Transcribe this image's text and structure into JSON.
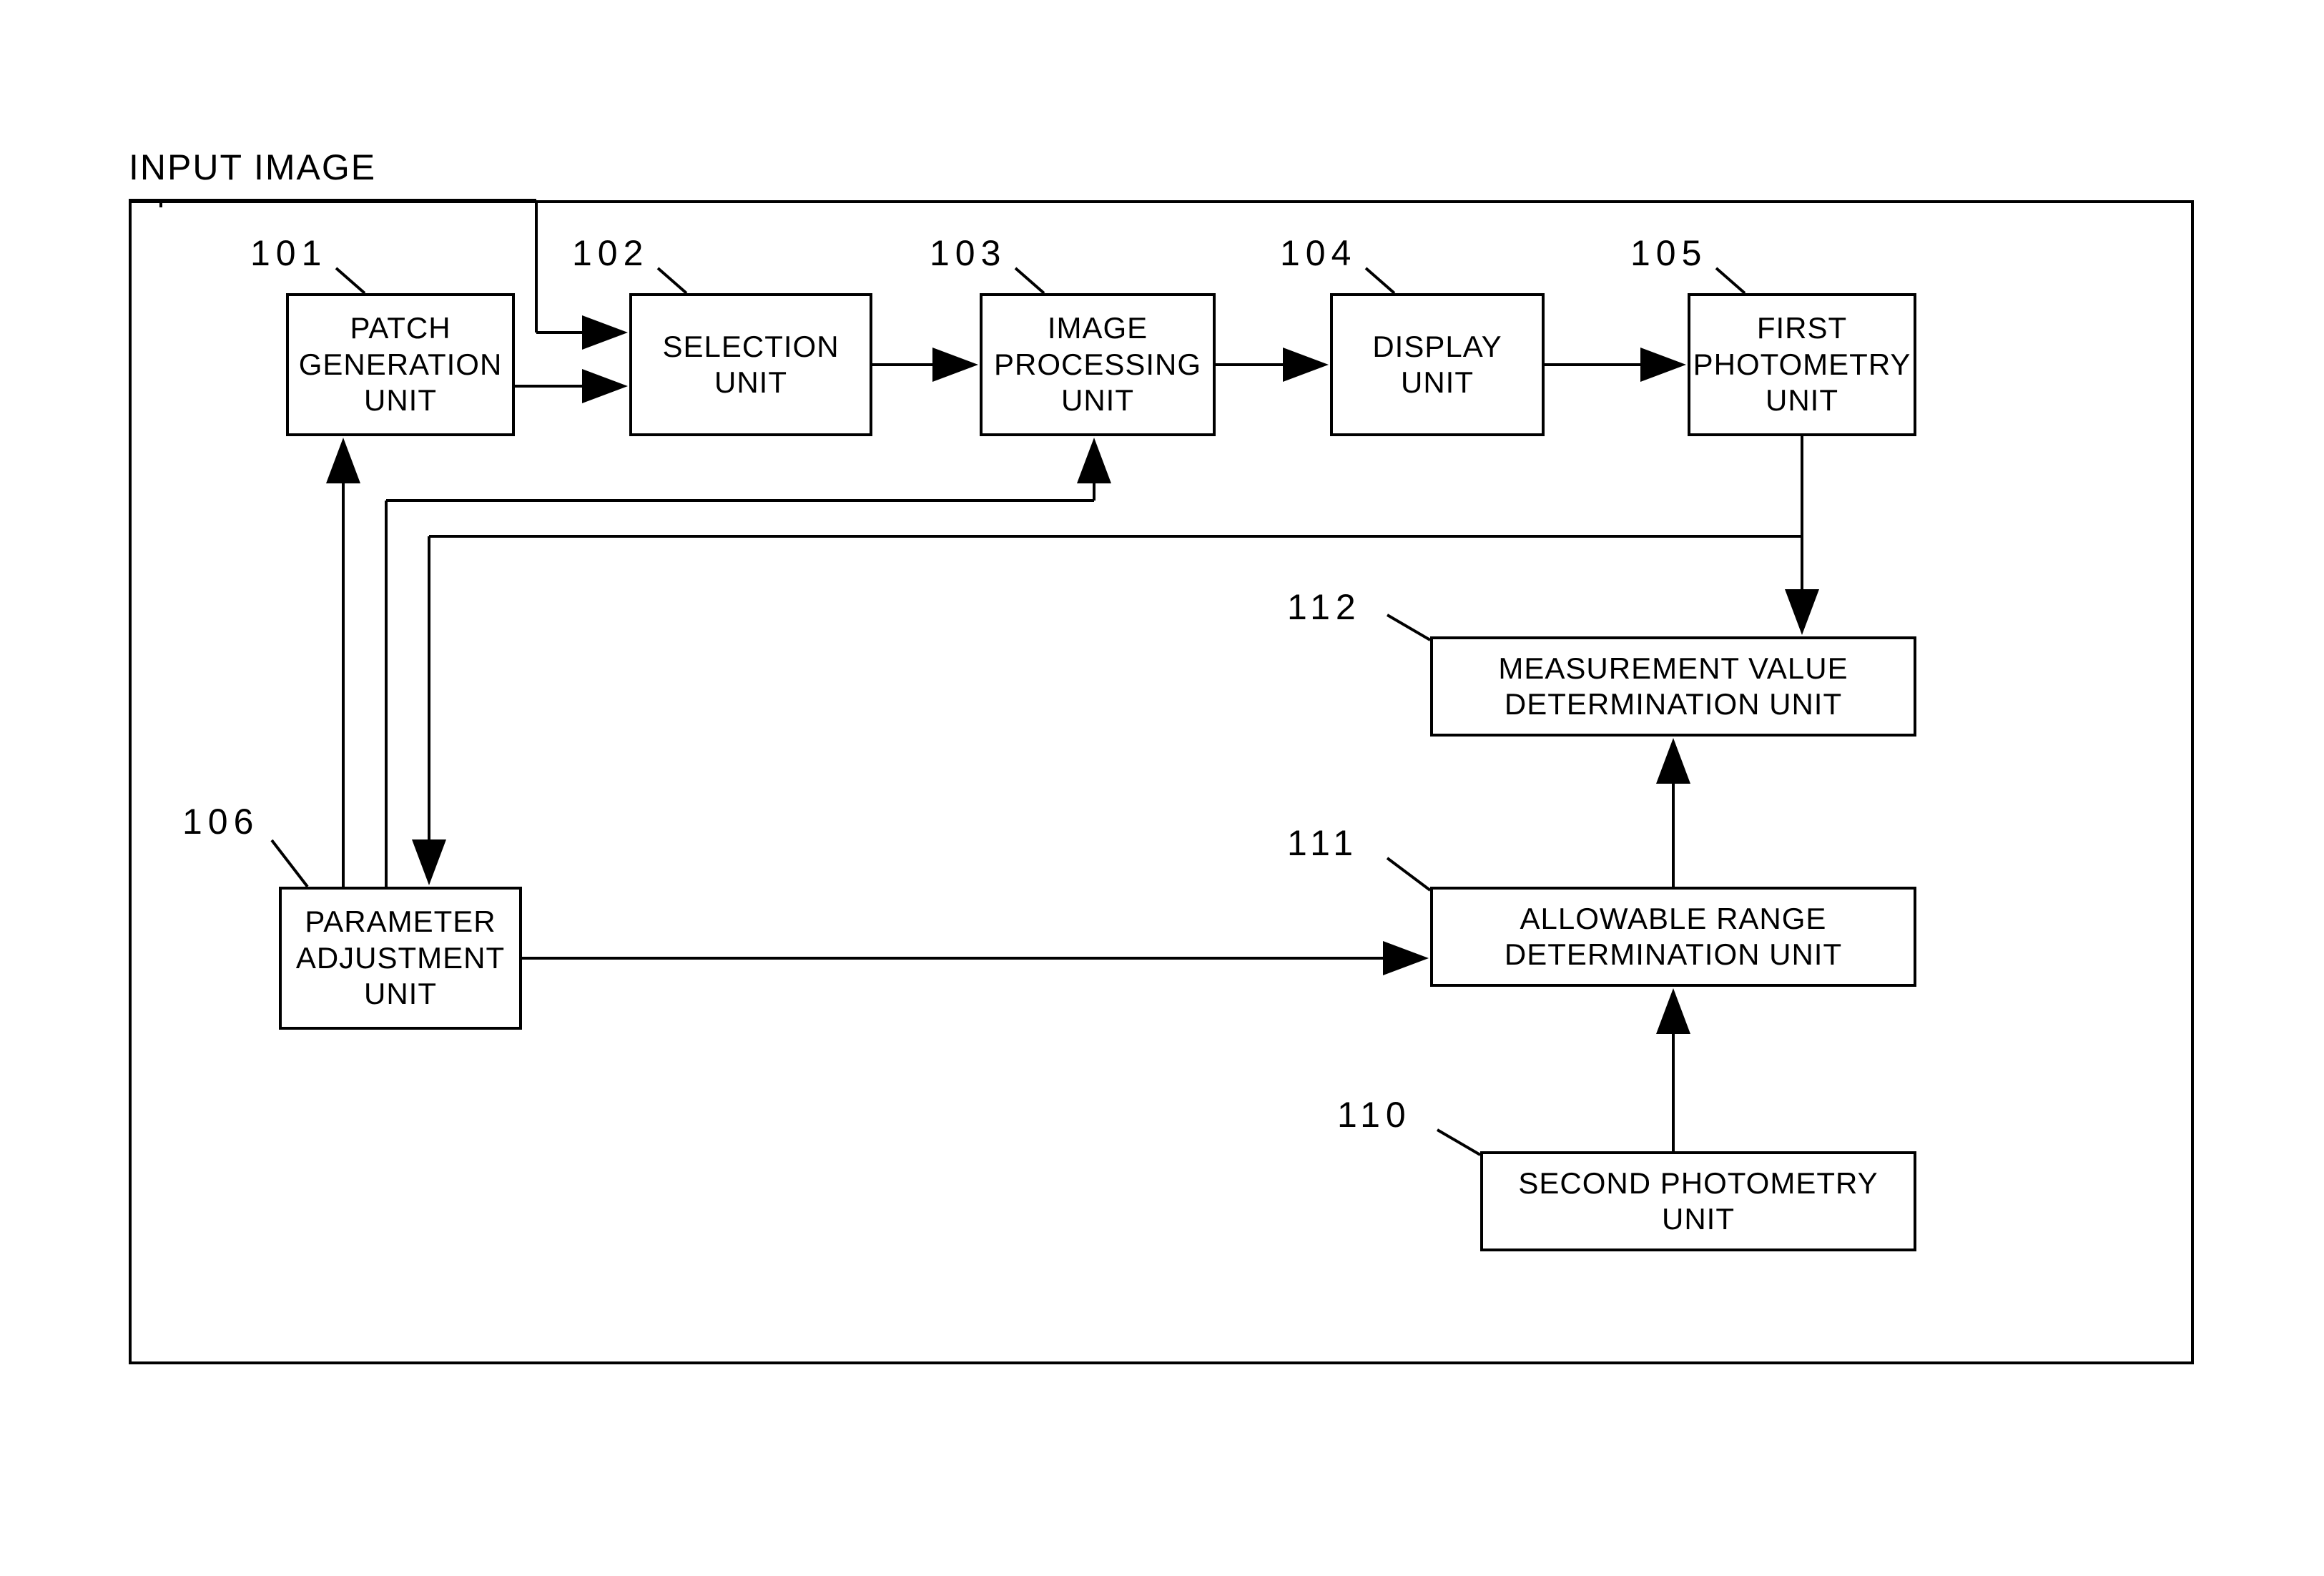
{
  "input_label": "INPUT IMAGE",
  "blocks": {
    "b101": {
      "num": "101",
      "text": "PATCH\nGENERATION\nUNIT"
    },
    "b102": {
      "num": "102",
      "text": "SELECTION\nUNIT"
    },
    "b103": {
      "num": "103",
      "text": "IMAGE\nPROCESSING\nUNIT"
    },
    "b104": {
      "num": "104",
      "text": "DISPLAY\nUNIT"
    },
    "b105": {
      "num": "105",
      "text": "FIRST\nPHOTOMETRY\nUNIT"
    },
    "b106": {
      "num": "106",
      "text": "PARAMETER\nADJUSTMENT\nUNIT"
    },
    "b110": {
      "num": "110",
      "text": "SECOND PHOTOMETRY\nUNIT"
    },
    "b111": {
      "num": "111",
      "text": "ALLOWABLE RANGE\nDETERMINATION UNIT"
    },
    "b112": {
      "num": "112",
      "text": "MEASUREMENT VALUE\nDETERMINATION UNIT"
    }
  }
}
